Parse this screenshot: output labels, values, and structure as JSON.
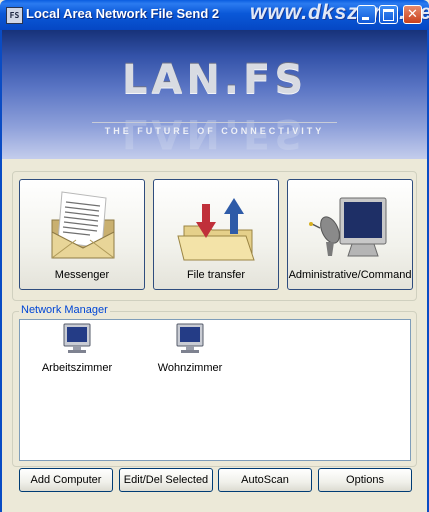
{
  "window": {
    "title": "Local Area Network File Send 2",
    "icon_text": "FS",
    "watermark": "www.dkszone.net"
  },
  "banner": {
    "logo": "LAN.FS",
    "tagline": "THE FUTURE OF CONNECTIVITY"
  },
  "modes": [
    {
      "label": "Messenger",
      "icon": "envelope-letter-icon"
    },
    {
      "label": "File transfer",
      "icon": "folder-transfer-icon"
    },
    {
      "label": "Administrative/Command",
      "icon": "satellite-monitor-icon"
    }
  ],
  "network_manager": {
    "title": "Network Manager",
    "computers": [
      {
        "name": "Arbeitszimmer",
        "icon": "computer-monitor-icon"
      },
      {
        "name": "Wohnzimmer",
        "icon": "computer-monitor-icon"
      }
    ]
  },
  "buttons": {
    "add_computer": "Add Computer",
    "edit_del": "Edit/Del Selected",
    "autoscan": "AutoScan",
    "options": "Options"
  },
  "colors": {
    "titlebar": "#0A58D8",
    "window_bg": "#ECE9D8",
    "group_title": "#0046D5",
    "close_button": "#C8401C"
  }
}
